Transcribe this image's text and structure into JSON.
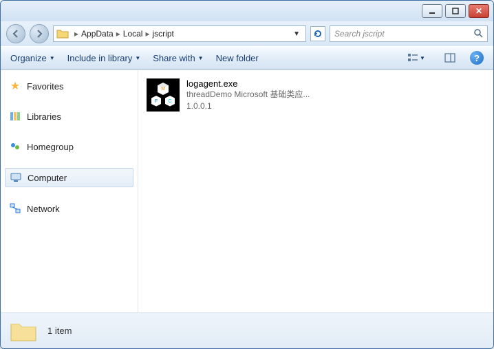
{
  "breadcrumb": {
    "parts": [
      "AppData",
      "Local",
      "jscript"
    ]
  },
  "search": {
    "placeholder": "Search jscript"
  },
  "toolbar": {
    "organize": "Organize",
    "include": "Include in library",
    "share": "Share with",
    "newfolder": "New folder"
  },
  "sidebar": {
    "items": [
      {
        "label": "Favorites",
        "icon": "star"
      },
      {
        "label": "Libraries",
        "icon": "lib"
      },
      {
        "label": "Homegroup",
        "icon": "hg"
      },
      {
        "label": "Computer",
        "icon": "comp",
        "selected": true
      },
      {
        "label": "Network",
        "icon": "net"
      }
    ]
  },
  "files": [
    {
      "name": "logagent.exe",
      "description": "threadDemo Microsoft 基础类应...",
      "version": "1.0.0.1"
    }
  ],
  "status": {
    "count_label": "1 item"
  }
}
